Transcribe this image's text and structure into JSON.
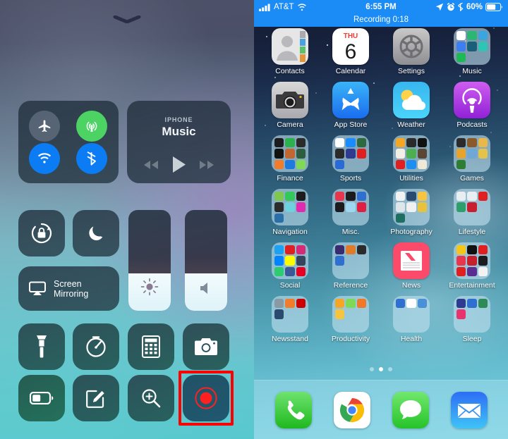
{
  "control_center": {
    "handle_icon": "chevron-down-icon",
    "toggles": [
      {
        "name": "airplane-mode",
        "icon": "airplane-icon",
        "state": "off"
      },
      {
        "name": "cellular-data",
        "icon": "cellular-antenna-icon",
        "state": "on"
      },
      {
        "name": "wifi",
        "icon": "wifi-icon",
        "state": "on"
      },
      {
        "name": "bluetooth",
        "icon": "bluetooth-icon",
        "state": "on"
      }
    ],
    "now_playing": {
      "device_label": "IPHONE",
      "title": "Music",
      "previous_icon": "rewind-icon",
      "play_icon": "play-icon",
      "next_icon": "fast-forward-icon"
    },
    "rotation_lock": {
      "label": "",
      "icon": "rotation-lock-icon"
    },
    "do_not_disturb": {
      "label": "",
      "icon": "moon-icon"
    },
    "screen_mirroring": {
      "label": "Screen\nMirroring",
      "label_line1": "Screen",
      "label_line2": "Mirroring",
      "icon": "airplay-icon"
    },
    "brightness_slider": {
      "icon": "brightness-icon",
      "value_percent": 37
    },
    "volume_slider": {
      "icon": "speaker-icon",
      "value_percent": 37
    },
    "shortcuts": [
      {
        "name": "flashlight",
        "icon": "flashlight-icon"
      },
      {
        "name": "timer",
        "icon": "timer-icon"
      },
      {
        "name": "calculator",
        "icon": "calculator-icon"
      },
      {
        "name": "camera",
        "icon": "camera-icon"
      },
      {
        "name": "low-power-mode",
        "icon": "battery-icon"
      },
      {
        "name": "notes",
        "icon": "notes-pencil-icon"
      },
      {
        "name": "magnifier",
        "icon": "magnifier-icon"
      },
      {
        "name": "screen-recording",
        "icon": "record-icon"
      }
    ],
    "highlight_color": "#ff0000",
    "highlighted_shortcut": "screen-recording"
  },
  "home_screen": {
    "status_bar": {
      "background_color": "#1b8cf5",
      "signal_icon": "signal-bars-icon",
      "carrier": "AT&T",
      "wifi_icon": "wifi-icon",
      "time": "6:55 PM",
      "location_icon": "location-arrow-icon",
      "alarm_icon": "alarm-clock-icon",
      "bluetooth_icon": "bluetooth-icon",
      "battery_percent": "60%",
      "battery_icon": "battery-icon",
      "recording_banner": "Recording  0:18"
    },
    "apps": [
      {
        "label": "Contacts",
        "type": "app",
        "icon": "contacts-icon"
      },
      {
        "label": "Calendar",
        "type": "app",
        "icon": "calendar-icon",
        "calendar_weekday": "Thursday",
        "calendar_day": "6"
      },
      {
        "label": "Settings",
        "type": "app",
        "icon": "settings-gear-icon"
      },
      {
        "label": "Music",
        "type": "folder",
        "mini_colors": [
          "#ffffff",
          "#2bb673",
          "#3aa6e0",
          "#3c7ff0",
          "#1a5f7a",
          "#2ec4b6",
          "#1db954",
          "",
          ""
        ]
      },
      {
        "label": "Camera",
        "type": "app",
        "icon": "camera-icon"
      },
      {
        "label": "App Store",
        "type": "app",
        "icon": "app-store-icon"
      },
      {
        "label": "Weather",
        "type": "app",
        "icon": "weather-icon"
      },
      {
        "label": "Podcasts",
        "type": "app",
        "icon": "podcasts-icon"
      },
      {
        "label": "Finance",
        "type": "folder",
        "mini_colors": [
          "#1c1c1e",
          "#2bb24c",
          "#2b2b2b",
          "#111111",
          "#c1672f",
          "#2e5c3e",
          "#f07c2c",
          "#1f7ae0",
          "#7ed957"
        ]
      },
      {
        "label": "Sports",
        "type": "folder",
        "mini_colors": [
          "#ffffff",
          "#1a8cff",
          "#2d6a3f",
          "#2b2b2b",
          "#2f3b8f",
          "#e02020",
          "#2a6ad6",
          "",
          ""
        ]
      },
      {
        "label": "Utilities",
        "type": "folder",
        "mini_colors": [
          "#f5a623",
          "#2b2b2b",
          "#111111",
          "#f2efe6",
          "#4caf50",
          "#5a4632",
          "#e02020",
          "#1f8ef1",
          "#efe9d8"
        ]
      },
      {
        "label": "Games",
        "type": "folder",
        "mini_colors": [
          "#2b2b2b",
          "#8b5a2b",
          "#e9b84a",
          "#e8a32b",
          "#6fa8d6",
          "#e4c34a",
          "#2e7d32",
          "",
          ""
        ]
      },
      {
        "label": "Navigation",
        "type": "folder",
        "mini_colors": [
          "#7ec850",
          "#34c759",
          "#1c1c1e",
          "#2b2b2b",
          "#6fd0e0",
          "#e02ab0",
          "#2b6fa8",
          "",
          ""
        ]
      },
      {
        "label": "Misc.",
        "type": "folder",
        "mini_colors": [
          "#e8364f",
          "#1c1c1e",
          "#2f6fd0",
          "#1c1c1e",
          "#9fd6f0",
          "#e02040",
          "",
          "",
          ""
        ]
      },
      {
        "label": "Photography",
        "type": "folder",
        "mini_colors": [
          "#f2f2f2",
          "#2b4a6f",
          "#f5c542",
          "#dfe6ea",
          "#f0f0f0",
          "#e8c23a",
          "#1f6f60",
          "",
          ""
        ]
      },
      {
        "label": "Lifestyle",
        "type": "folder",
        "mini_colors": [
          "#e8eef2",
          "#e8eef2",
          "#e02020",
          "#2e9e6b",
          "#c81f2f",
          "",
          "",
          "",
          ""
        ]
      },
      {
        "label": "Social",
        "type": "folder",
        "mini_colors": [
          "#1da1f2",
          "#e02020",
          "#d62976",
          "#0084ff",
          "#fffc00",
          "#35465c",
          "#2ecc71",
          "#3b5998",
          "#e60023"
        ]
      },
      {
        "label": "Reference",
        "type": "folder",
        "mini_colors": [
          "#3a2b6f",
          "#e07b2a",
          "#2b2b2b",
          "#2f6fd0",
          "",
          "",
          "",
          "",
          ""
        ]
      },
      {
        "label": "News",
        "type": "app",
        "icon": "news-icon"
      },
      {
        "label": "Entertainment",
        "type": "folder",
        "mini_colors": [
          "#f5c518",
          "#111111",
          "#e02020",
          "#e8364f",
          "#c81f2f",
          "#1c1c1e",
          "#e02020",
          "#5c2d91",
          "#f2f2f2"
        ]
      },
      {
        "label": "Newsstand",
        "type": "folder",
        "mini_colors": [
          "#8a9aa5",
          "#f07c2c",
          "#cc0000",
          "#2b4a6f",
          "",
          "",
          "",
          "",
          ""
        ]
      },
      {
        "label": "Productivity",
        "type": "folder",
        "mini_colors": [
          "#f5a623",
          "#7ed957",
          "#f0782a",
          "#f5c542",
          "",
          "",
          "",
          "",
          ""
        ]
      },
      {
        "label": "Health",
        "type": "folder",
        "mini_colors": [
          "#2f6fd0",
          "#ffffff",
          "#4a90d9",
          "",
          "",
          "",
          "",
          "",
          ""
        ]
      },
      {
        "label": "Sleep",
        "type": "folder",
        "mini_colors": [
          "#2f3b8f",
          "#2f6fd0",
          "#2e8b57",
          "#e8336f",
          "",
          "",
          "",
          "",
          ""
        ]
      }
    ],
    "page_dots": {
      "count": 3,
      "active_index": 1
    },
    "dock": [
      {
        "label": "Phone",
        "icon": "phone-icon"
      },
      {
        "label": "Chrome",
        "icon": "chrome-icon"
      },
      {
        "label": "Messages",
        "icon": "messages-icon"
      },
      {
        "label": "Mail",
        "icon": "mail-icon"
      }
    ]
  }
}
